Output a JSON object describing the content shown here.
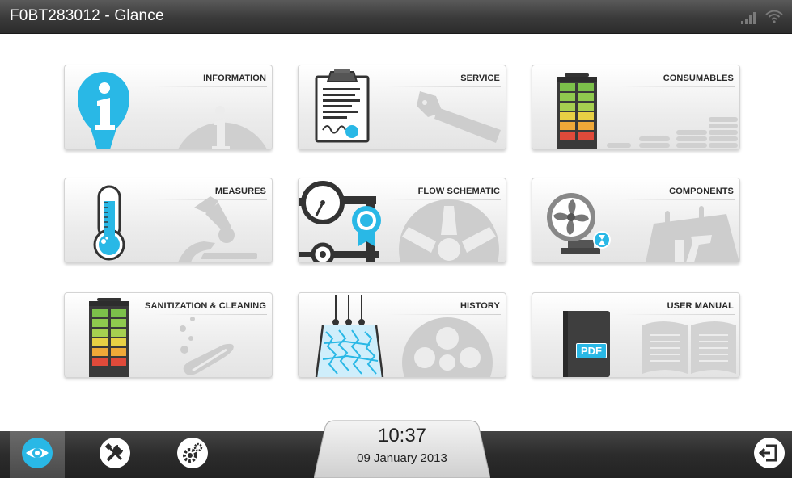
{
  "header": {
    "title": "F0BT283012 - Glance",
    "icons": [
      "signal-strength-icon",
      "wifi-icon"
    ]
  },
  "tiles": [
    {
      "id": "information",
      "label": "INFORMATION",
      "icon": "info-icon"
    },
    {
      "id": "service",
      "label": "SERVICE",
      "icon": "clipboard-icon"
    },
    {
      "id": "consumables",
      "label": "CONSUMABLES",
      "icon": "cartridge-icon"
    },
    {
      "id": "measures",
      "label": "MEASURES",
      "icon": "thermometer-icon"
    },
    {
      "id": "flow-schematic",
      "label": "FLOW SCHEMATIC",
      "icon": "gauge-icon"
    },
    {
      "id": "components",
      "label": "COMPONENTS",
      "icon": "fan-icon"
    },
    {
      "id": "sanitization",
      "label": "SANITIZATION & CLEANING",
      "icon": "cartridge-icon"
    },
    {
      "id": "history",
      "label": "HISTORY",
      "icon": "water-flow-icon"
    },
    {
      "id": "user-manual",
      "label": "USER MANUAL",
      "icon": "pdf-book-icon"
    }
  ],
  "user_manual": {
    "badge": "PDF"
  },
  "footer": {
    "time": "10:37",
    "date": "09 January 2013",
    "nav": [
      "eye-icon",
      "tools-icon",
      "gears-icon",
      "logout-icon"
    ]
  },
  "colors": {
    "accent": "#29b8e6",
    "bar_dark": "#2c2c2c",
    "tile_label": "#2a2a2a"
  }
}
